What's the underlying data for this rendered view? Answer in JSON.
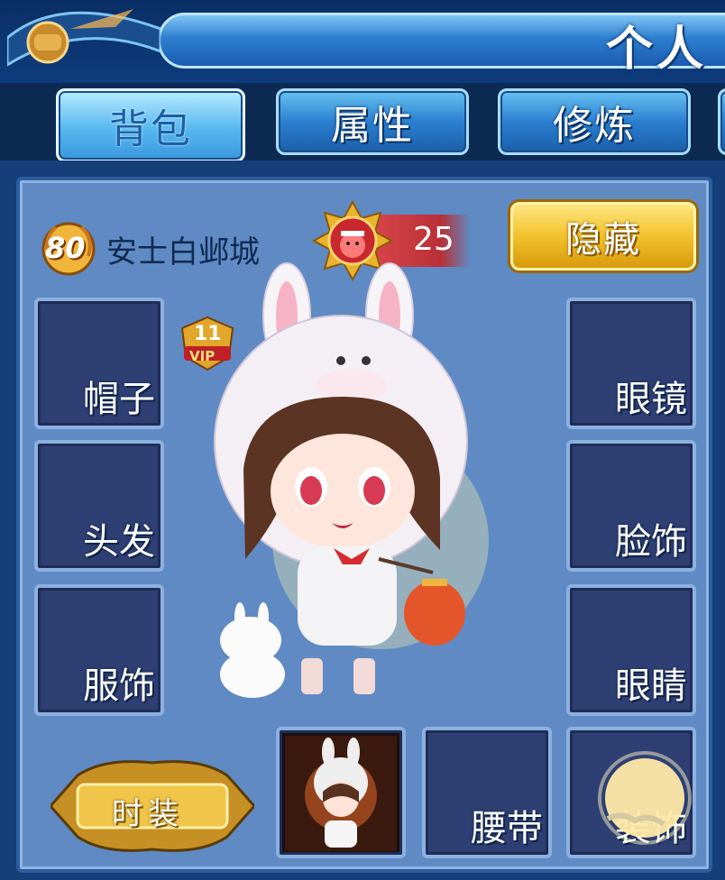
{
  "header": {
    "title": "个人资"
  },
  "tabs": [
    {
      "label": "背包",
      "active": true
    },
    {
      "label": "属性",
      "active": false
    },
    {
      "label": "修炼",
      "active": false
    }
  ],
  "player": {
    "level": "80",
    "name": "安士白邺城",
    "vip_level": "11",
    "vip_text": "VIP"
  },
  "currency": {
    "count": "25"
  },
  "hide_button": {
    "label": "隐藏"
  },
  "slots_left": [
    "帽子",
    "头发",
    "服饰"
  ],
  "slots_right": [
    "眼镜",
    "脸饰",
    "眼睛"
  ],
  "slots_bottom": [
    "",
    "腰带",
    "装饰"
  ],
  "fashion_button": {
    "label": "时装"
  },
  "colors": {
    "panel": "#5f8ac4",
    "slot": "#2e3f73",
    "accent_gold": "#f2c22c",
    "tab_blue": "#2b7fd0"
  }
}
